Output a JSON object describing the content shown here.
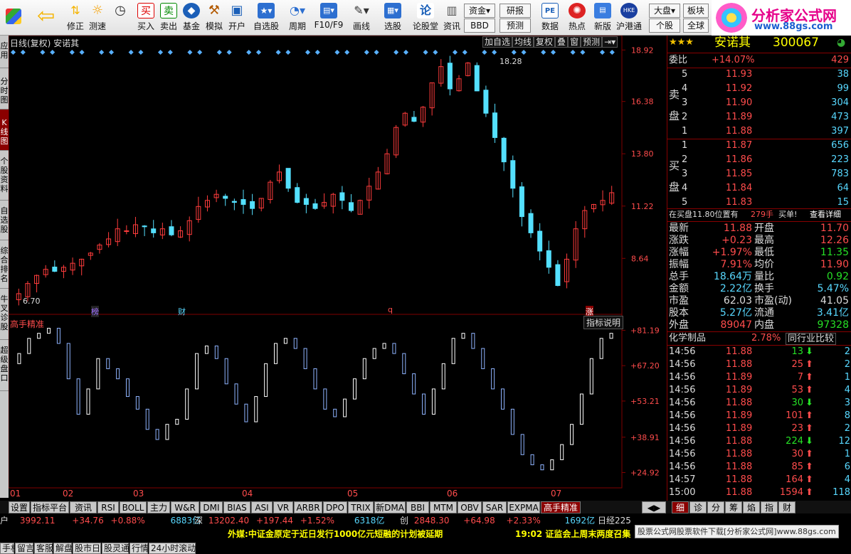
{
  "toolbar": {
    "items": [
      {
        "label": "",
        "icon": "grid-icon"
      },
      {
        "label": "",
        "icon": "back-arrow-icon"
      },
      {
        "label": "修正",
        "icon": "up-down-arrows-icon"
      },
      {
        "label": "测速",
        "icon": "sun-refresh-icon"
      },
      {
        "label": "",
        "icon": "clock-icon"
      },
      {
        "label": "买入",
        "icon": "buy-icon",
        "glyph": "买"
      },
      {
        "label": "卖出",
        "icon": "sell-icon",
        "glyph": "卖"
      },
      {
        "label": "基金",
        "icon": "fund-icon"
      },
      {
        "label": "模拟",
        "icon": "hammer-icon"
      },
      {
        "label": "开户",
        "icon": "account-icon"
      },
      {
        "label": "自选股",
        "icon": "star-list-icon"
      },
      {
        "label": "周期",
        "icon": "period-icon"
      },
      {
        "label": "F10/F9",
        "icon": "f10-icon"
      },
      {
        "label": "画线",
        "icon": "pencil-icon"
      },
      {
        "label": "选股",
        "icon": "screen-icon"
      },
      {
        "label": "论股堂",
        "icon": "forum-icon",
        "glyph": "论"
      },
      {
        "label": "资讯",
        "icon": "news-icon"
      },
      {
        "label": "数据",
        "icon": "pe-icon",
        "glyph": "PE"
      },
      {
        "label": "热点",
        "icon": "hot-icon"
      },
      {
        "label": "新版",
        "icon": "newversion-icon"
      },
      {
        "label": "沪港通",
        "icon": "hk-icon",
        "glyph": "HKE"
      }
    ],
    "small_buttons": [
      {
        "label": "资金",
        "icon": "dropdown-icon"
      },
      {
        "label": "BBD"
      },
      {
        "label": "研报"
      },
      {
        "label": "预测"
      },
      {
        "label": "大盘",
        "icon": "dropdown-icon"
      },
      {
        "label": "个股"
      },
      {
        "label": "板块"
      },
      {
        "label": "全球"
      }
    ]
  },
  "logo": {
    "title": "分析家公式网",
    "url_text": "www.88gs.com"
  },
  "vtabs": [
    {
      "label": "应用"
    },
    {
      "label": "分时图"
    },
    {
      "label": "K线图"
    },
    {
      "label": "个股资料"
    },
    {
      "label": "自选股"
    },
    {
      "label": "综合排名"
    },
    {
      "label": "牛叉诊股"
    },
    {
      "label": "超级盘口"
    }
  ],
  "chart": {
    "title": "日线(复权) 安诺其",
    "buttons": [
      "加自选",
      "均线",
      "复权",
      "叠",
      "窗",
      "预测"
    ],
    "markers": [
      {
        "label": "榜"
      },
      {
        "label": "财"
      },
      {
        "label": "q"
      },
      {
        "label": "涨"
      }
    ],
    "high_label": "18.28",
    "low_label": "6.70",
    "indicator_title": "高手精准",
    "indicator_btn": "指标说明",
    "x_labels": [
      "01",
      "02",
      "03",
      "04",
      "05",
      "06",
      "07"
    ]
  },
  "chart_data": [
    {
      "type": "candlestick",
      "title": "日线(复权) 安诺其",
      "y_ticks": [
        "18.92",
        "16.38",
        "13.80",
        "11.22",
        "8.64"
      ],
      "ylim": [
        6.3,
        19.0
      ],
      "x_ticks": [
        "01",
        "02",
        "03",
        "04",
        "05",
        "06",
        "07"
      ],
      "annotations": [
        "18.28",
        "6.70"
      ],
      "values": [
        6.9,
        7.4,
        7.8,
        8.1,
        8.0,
        8.2,
        8.4,
        8.6,
        8.9,
        9.3,
        9.6,
        10.1,
        10.0,
        10.3,
        10.2,
        9.9,
        10.1,
        9.8,
        10.0,
        10.5,
        11.2,
        11.5,
        11.8,
        11.6,
        11.4,
        11.3,
        11.1,
        11.6,
        12.4,
        12.9,
        12.1,
        11.4,
        11.3,
        11.1,
        11.4,
        11.8,
        11.5,
        11.0,
        11.5,
        12.2,
        12.9,
        13.8,
        15.1,
        15.8,
        15.4,
        16.1,
        17.3,
        18.1,
        17.0,
        17.5,
        18.28,
        16.9,
        15.8,
        14.6,
        13.4,
        12.1,
        10.7,
        9.9,
        9.0,
        8.2,
        7.3,
        8.6,
        10.1,
        11.0,
        11.3,
        11.5,
        11.88
      ]
    },
    {
      "type": "bar",
      "title": "高手精准",
      "y_ticks": [
        "+81.19",
        "+67.20",
        "+53.21",
        "+38.91",
        "+24.92"
      ],
      "ylim": [
        20,
        83
      ],
      "values": [
        72,
        78,
        80,
        82,
        76,
        62,
        48,
        58,
        70,
        66,
        62,
        55,
        50,
        42,
        38,
        44,
        46,
        58,
        72,
        75,
        70,
        60,
        52,
        45,
        55,
        68,
        76,
        78,
        74,
        66,
        58,
        50,
        47,
        54,
        62,
        70,
        74,
        76,
        72,
        64,
        56,
        48,
        58,
        68,
        78,
        80,
        74,
        66,
        58,
        50,
        40,
        32,
        28,
        26,
        30,
        36,
        44,
        56,
        70,
        78,
        80
      ]
    }
  ],
  "quote": {
    "stars": "★★★",
    "name": "安诺其",
    "code": "300067",
    "wb_label": "委比",
    "wb_value": "+14.07%",
    "wb_diff": "429",
    "sell_label": "卖盘",
    "buy_label": "买盘",
    "sell": [
      {
        "lv": "5",
        "price": "11.93",
        "vol": "38"
      },
      {
        "lv": "4",
        "price": "11.92",
        "vol": "99"
      },
      {
        "lv": "3",
        "price": "11.90",
        "vol": "304"
      },
      {
        "lv": "2",
        "price": "11.89",
        "vol": "473"
      },
      {
        "lv": "1",
        "price": "11.88",
        "vol": "397"
      }
    ],
    "buy": [
      {
        "lv": "1",
        "price": "11.87",
        "vol": "656"
      },
      {
        "lv": "2",
        "price": "11.86",
        "vol": "223"
      },
      {
        "lv": "3",
        "price": "11.85",
        "vol": "783"
      },
      {
        "lv": "4",
        "price": "11.84",
        "vol": "64"
      },
      {
        "lv": "5",
        "price": "11.83",
        "vol": "15"
      }
    ],
    "position_text": "在买盘11.80位置有",
    "position_vol": "279手",
    "buy_single": "买单!",
    "detail_link": "查看详细",
    "stats": [
      {
        "k1": "最新",
        "v1": "11.88",
        "k2": "开盘",
        "v2": "11.70"
      },
      {
        "k1": "涨跌",
        "v1": "+0.23",
        "k2": "最高",
        "v2": "12.26"
      },
      {
        "k1": "涨幅",
        "v1": "+1.97%",
        "k2": "最低",
        "v2": "11.35"
      },
      {
        "k1": "振幅",
        "v1": "7.91%",
        "k2": "均价",
        "v2": "11.90"
      },
      {
        "k1": "总手",
        "v1": "18.64万",
        "k2": "量比",
        "v2": "0.92"
      },
      {
        "k1": "金额",
        "v1": "2.22亿",
        "k2": "换手",
        "v2": "5.47%"
      },
      {
        "k1": "市盈",
        "v1": "62.03",
        "k2": "市盈(动)",
        "v2": "41.05"
      },
      {
        "k1": "股本",
        "v1": "5.27亿",
        "k2": "流通",
        "v2": "3.41亿"
      },
      {
        "k1": "外盘",
        "v1": "89047",
        "k2": "内盘",
        "v2": "97328"
      }
    ],
    "sector": "化学制品",
    "sector_pct": "2.78%",
    "compare_btn": "同行业比较",
    "ticks": [
      {
        "t": "14:56",
        "p": "11.88",
        "v": "13",
        "dir": "down",
        "n": "2"
      },
      {
        "t": "14:56",
        "p": "11.88",
        "v": "25",
        "dir": "up",
        "n": "2"
      },
      {
        "t": "14:56",
        "p": "11.89",
        "v": "7",
        "dir": "up",
        "n": "1"
      },
      {
        "t": "14:56",
        "p": "11.89",
        "v": "53",
        "dir": "up",
        "n": "4"
      },
      {
        "t": "14:56",
        "p": "11.88",
        "v": "30",
        "dir": "down",
        "n": "3"
      },
      {
        "t": "14:56",
        "p": "11.89",
        "v": "101",
        "dir": "up",
        "n": "8"
      },
      {
        "t": "14:56",
        "p": "11.89",
        "v": "23",
        "dir": "up",
        "n": "2"
      },
      {
        "t": "14:56",
        "p": "11.88",
        "v": "224",
        "dir": "down",
        "n": "12"
      },
      {
        "t": "14:56",
        "p": "11.88",
        "v": "30",
        "dir": "up",
        "n": "1"
      },
      {
        "t": "14:56",
        "p": "11.88",
        "v": "85",
        "dir": "up",
        "n": "6"
      },
      {
        "t": "14:57",
        "p": "11.88",
        "v": "164",
        "dir": "up",
        "n": "4"
      },
      {
        "t": "15:00",
        "p": "11.88",
        "v": "1594",
        "dir": "up",
        "n": "118"
      }
    ]
  },
  "bottom_tabs": [
    "设置",
    "指标平台",
    "资讯",
    "RSI",
    "BOLL",
    "主力",
    "W&R",
    "DMI",
    "BIAS",
    "ASI",
    "VR",
    "ARBR",
    "DPO",
    "TRIX",
    "新DMA",
    "BBI",
    "MTM",
    "OBV",
    "SAR",
    "EXPMA",
    "高手精准"
  ],
  "right_tabs": [
    "细",
    "诊",
    "分",
    "筹",
    "焰",
    "指",
    "财"
  ],
  "status": {
    "sh_label": "户",
    "sh_val": "3992.11",
    "sh_chg": "+34.76",
    "sh_pct": "+0.88%",
    "sh_amt": "6883亿",
    "sz_label": "深",
    "sz_val": "13202.40",
    "sz_chg": "+197.44",
    "sz_pct": "+1.52%",
    "sz_amt": "6318亿",
    "cy_label": "创",
    "cy_val": "2848.30",
    "cy_chg": "+64.98",
    "cy_pct": "+2.33%",
    "cy_amt": "1692亿",
    "nk_label": "日经225",
    "buttons": [
      "手机",
      "留言",
      "客服",
      "解盘",
      "股市日记",
      "股灵通",
      "行情",
      "24小时滚动"
    ],
    "news_label": "外媒:",
    "news_text": "中证金原定于近日发行1000亿元短融的计划被延期",
    "news2_time": "19:02",
    "news2_text": "证监会上周末两度召集",
    "footer_link": "股票公式网股票软件下载[分析家公式网]www.88gs.com"
  },
  "colors": {
    "up": "#ff3c3c",
    "down": "#54e0ff",
    "grid": "#800000",
    "accent": "#8b0000"
  }
}
